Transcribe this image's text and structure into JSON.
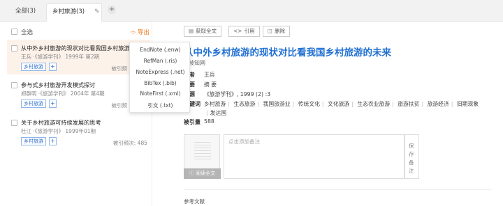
{
  "tabs": {
    "all": "全部(3)",
    "active": "乡村旅游(3)",
    "add": "+"
  },
  "list": {
    "select_all": "全选",
    "export": "导出",
    "items": [
      {
        "title": "从中外乡村旅游的现状对比看我国乡村旅游的",
        "meta": "王兵  ·《旅游学刊》 1999年 第2期",
        "tag": "乡村旅游",
        "cite": "被引频"
      },
      {
        "title": "参与式乡村旅游开发模式探讨",
        "meta": "郑群明  ·《旅游学刊》 2004年 第4期",
        "tag": "乡村旅游",
        "cite": "被引频"
      },
      {
        "title": "关于乡村旅游可持续发展的思考",
        "meta": "杜江  ·《旅游学刊》 1999年01期",
        "tag": "乡村旅游",
        "cite": "被引频次: 485"
      }
    ]
  },
  "export_menu": [
    "EndNote (.enw)",
    "RefMan (.ris)",
    "NoteExpress (.net)",
    "BibTex (.bib)",
    "NoteFirst (.xml)",
    "引文 (.txt)"
  ],
  "toolbar": {
    "fulltext": "获取全文",
    "cite": "引用",
    "delete": "删除"
  },
  "detail": {
    "title": "从中外乡村旅游的现状对比看我国乡村旅游的未来",
    "subtitle": "被知网",
    "author_label": "作者",
    "author": "王兵",
    "abstract_label": "摘要",
    "abstract": "摘    要",
    "source_label": "来源",
    "source": "《旅游学刊》, 1999 (2) :3",
    "keywords_label": "关键词",
    "keywords": [
      "乡村旅游",
      "生态旅游",
      "我国旅游业",
      "传统文化",
      "文化旅游",
      "生态农业旅游",
      "旅游扶贫",
      "旅游经济",
      "旧期现象"
    ],
    "keywords_extra": "发达国",
    "cited_label": "被引量",
    "cited": "588",
    "read_fulltext": "阅读全文",
    "note_placeholder": "点击添加备注",
    "save_note": [
      "保",
      "存",
      "备",
      "注"
    ],
    "refs": "参考文献"
  }
}
